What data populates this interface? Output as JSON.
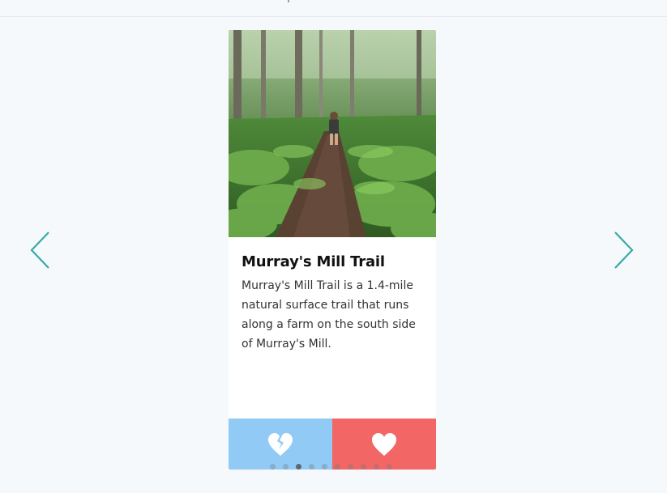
{
  "carousel": {
    "prev_icon": "chevron-left-icon",
    "next_icon": "chevron-right-icon",
    "accent_color": "#3aa9a6"
  },
  "card": {
    "title": "Murray's Mill Trail",
    "description": "Murray's Mill Trail is a 1.4-mile natural surface trail that runs along a farm on the south side of Murray's Mill.",
    "image": "forest-trail-hiker-photo",
    "dislike_icon": "broken-heart-icon",
    "like_icon": "heart-icon",
    "dislike_color": "#90caf5",
    "like_color": "#f26666"
  },
  "pagination": {
    "total": 10,
    "active_index": 2
  }
}
